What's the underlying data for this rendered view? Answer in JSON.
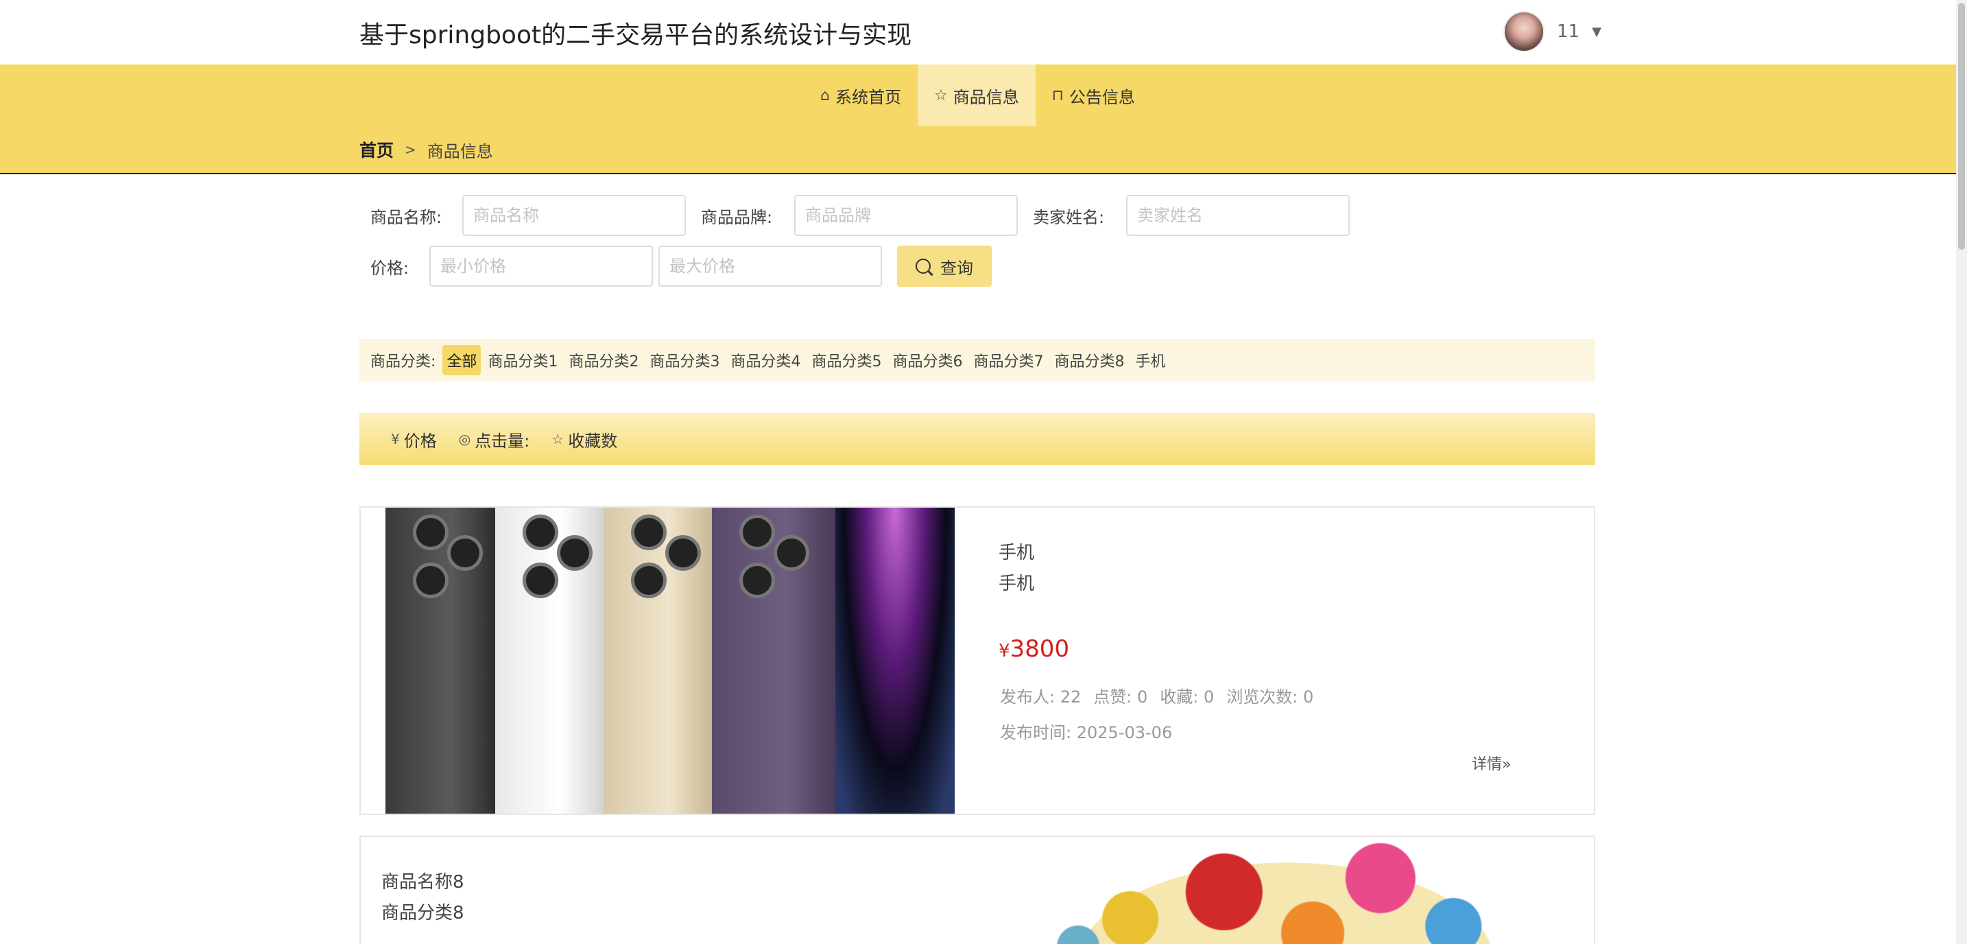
{
  "header": {
    "title": "基于springboot的二手交易平台的系统设计与实现",
    "user_name": "11",
    "caret": "▼"
  },
  "nav": {
    "items": [
      {
        "label": "系统首页",
        "icon": "home-icon",
        "glyph": "⌂",
        "active": false
      },
      {
        "label": "商品信息",
        "icon": "star-icon",
        "glyph": "☆",
        "active": true
      },
      {
        "label": "公告信息",
        "icon": "bag-icon",
        "glyph": "⊓",
        "active": false
      }
    ]
  },
  "breadcrumb": {
    "home": "首页",
    "separator": ">",
    "current": "商品信息"
  },
  "search": {
    "name_label": "商品名称:",
    "name_placeholder": "商品名称",
    "brand_label": "商品品牌:",
    "brand_placeholder": "商品品牌",
    "seller_label": "卖家姓名:",
    "seller_placeholder": "卖家姓名",
    "price_label": "价格:",
    "min_placeholder": "最小价格",
    "max_placeholder": "最大价格",
    "query_label": "查询"
  },
  "categories": {
    "label": "商品分类:",
    "items": [
      "全部",
      "商品分类1",
      "商品分类2",
      "商品分类3",
      "商品分类4",
      "商品分类5",
      "商品分类6",
      "商品分类7",
      "商品分类8",
      "手机"
    ]
  },
  "sort": {
    "price": "价格",
    "price_glyph": "¥",
    "clicks": "点击量:",
    "clicks_glyph": "◎",
    "favorites": "收藏数",
    "favorites_glyph": "☆"
  },
  "products": [
    {
      "name": "手机",
      "category": "手机",
      "currency": "¥",
      "price": "3800",
      "publisher_label": "发布人:",
      "publisher": "22",
      "likes_label": "点赞:",
      "likes": "0",
      "favorites_label": "收藏:",
      "favorites": "0",
      "views_label": "浏览次数:",
      "views": "0",
      "time_label": "发布时间:",
      "time": "2025-03-06",
      "detail": "详情»"
    },
    {
      "name": "商品名称8",
      "category": "商品分类8"
    }
  ],
  "colors": {
    "accent": "#f5d866",
    "price": "#d0201d"
  }
}
